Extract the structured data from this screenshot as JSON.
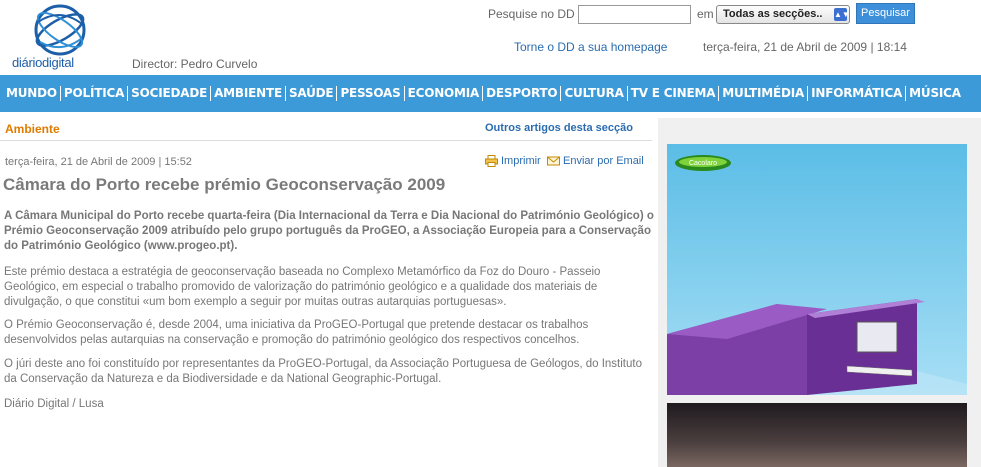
{
  "header": {
    "logo_text_a": "diário",
    "logo_text_b": "digital",
    "director": "Director: Pedro Curvelo",
    "search_label": "Pesquise no DD",
    "search_value": "",
    "em_label": "em",
    "section_select": "Todas as secções..",
    "search_button": "Pesquisar",
    "homepage_link": "Torne o DD a sua homepage",
    "datetime": "terça-feira, 21 de Abril de 2009 | 18:14"
  },
  "nav": {
    "items": [
      "MUNDO",
      "POLÍTICA",
      "SOCIEDADE",
      "AMBIENTE",
      "SAÚDE",
      "PESSOAS",
      "ECONOMIA",
      "DESPORTO",
      "CULTURA",
      "TV E CINEMA",
      "MULTIMÉDIA",
      "INFORMÁTICA",
      "MÚSICA"
    ]
  },
  "article": {
    "section": "Ambiente",
    "other_articles": "Outros artigos desta secção",
    "date": "terça-feira, 21 de Abril de 2009 | 15:52",
    "print": "Imprimir",
    "email": "Enviar por Email",
    "title": "Câmara do Porto recebe prémio Geoconservação 2009",
    "lead": "A Câmara Municipal do Porto recebe quarta-feira (Dia Internacional da Terra e Dia Nacional do Património Geológico) o Prémio Geoconservação 2009 atribuído pelo grupo português da ProGEO, a Associação Europeia para a Conservação do Património Geológico (www.progeo.pt).",
    "paragraphs": [
      "Este prémio destaca a estratégia de geoconservação baseada no Complexo Metamórfico da Foz do Douro - Passeio Geológico, em especial o trabalho promovido de valorização do património geológico e a qualidade dos materiais de divulgação, o que constitui «um bom exemplo a seguir por muitas outras autarquias portuguesas».",
      "O Prémio Geoconservação é, desde 2004, uma iniciativa da ProGEO-Portugal que pretende destacar os trabalhos desenvolvidos pelas autarquias na conservação e promoção do património geológico dos respectivos concelhos.",
      "O júri deste ano foi constituído por representantes da ProGEO-Portugal, da Associação Portuguesa de Geólogos, do Instituto da Conservação da Natureza e da Biodiversidade e da National Geographic-Portugal."
    ],
    "source": "Diário Digital / Lusa"
  },
  "ad": {
    "badge_text": "Cacolaro"
  },
  "colors": {
    "nav_bg": "#3d9ad8",
    "section_orange": "#e07b00",
    "link_blue": "#2a6cb0",
    "ad_purple": "#7b3fa6"
  }
}
